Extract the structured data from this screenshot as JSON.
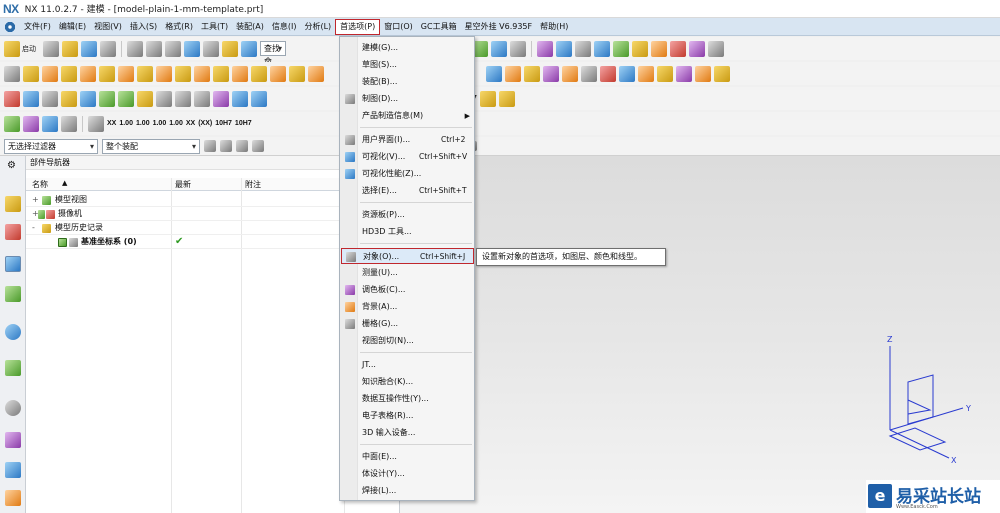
{
  "window": {
    "logo": "NX",
    "title": "NX 11.0.2.7 - 建模 - [model-plain-1-mm-template.prt]"
  },
  "menubar": {
    "items": [
      "文件(F)",
      "编辑(E)",
      "视图(V)",
      "插入(S)",
      "格式(R)",
      "工具(T)",
      "装配(A)",
      "信息(I)",
      "分析(L)",
      "首选项(P)",
      "窗口(O)",
      "GC工具箱",
      "星空外挂 V6.935F",
      "帮助(H)"
    ],
    "active_index": 9
  },
  "toolbar": {
    "start_label": "启动",
    "search_label": "查找命"
  },
  "filter": {
    "type_filter": "无选择过滤器",
    "assembly_scope": "整个装配"
  },
  "navigator": {
    "title": "部件导航器",
    "columns": [
      "名称",
      "最新",
      "附注"
    ],
    "rows": [
      {
        "label": "模型视图",
        "expand": "+"
      },
      {
        "label": "摄像机",
        "expand": "+"
      },
      {
        "label": "模型历史记录",
        "expand": "-"
      },
      {
        "label": "基准坐标系 (0)",
        "expand": "",
        "latest": "✔"
      }
    ]
  },
  "preferences_menu": {
    "items": [
      {
        "label": "建模(G)..."
      },
      {
        "label": "草图(S)..."
      },
      {
        "label": "装配(B)..."
      },
      {
        "label": "制图(D)..."
      },
      {
        "label": "产品制造信息(M)",
        "submenu": true
      },
      {
        "label": "用户界面(I)...",
        "shortcut": "Ctrl+2"
      },
      {
        "label": "可视化(V)...",
        "shortcut": "Ctrl+Shift+V"
      },
      {
        "label": "可视化性能(Z)..."
      },
      {
        "label": "选择(E)...",
        "shortcut": "Ctrl+Shift+T"
      },
      {
        "label": "资源板(P)..."
      },
      {
        "label": "HD3D 工具..."
      },
      {
        "label": "对象(O)...",
        "shortcut": "Ctrl+Shift+J"
      },
      {
        "label": "测量(U)..."
      },
      {
        "label": "调色板(C)..."
      },
      {
        "label": "背景(A)..."
      },
      {
        "label": "栅格(G)..."
      },
      {
        "label": "视图剖切(N)..."
      },
      {
        "label": "JT..."
      },
      {
        "label": "知识融合(K)..."
      },
      {
        "label": "数据互操作性(Y)..."
      },
      {
        "label": "电子表格(R)..."
      },
      {
        "label": "3D 输入设备..."
      },
      {
        "label": "中面(E)..."
      },
      {
        "label": "体设计(Y)..."
      },
      {
        "label": "焊接(L)..."
      }
    ],
    "highlighted_index": 11
  },
  "tooltip": "设置新对象的首选项，如图层、颜色和线型。",
  "triad": {
    "z": "Z",
    "y": "Y",
    "x": "X"
  },
  "watermark": {
    "text": "易采站长站",
    "sub": "Www.Easck.Com"
  },
  "colors": {
    "menubar": "#d8e5f2",
    "highlight_border": "#c0272d",
    "triad": "#2a3bd0"
  }
}
